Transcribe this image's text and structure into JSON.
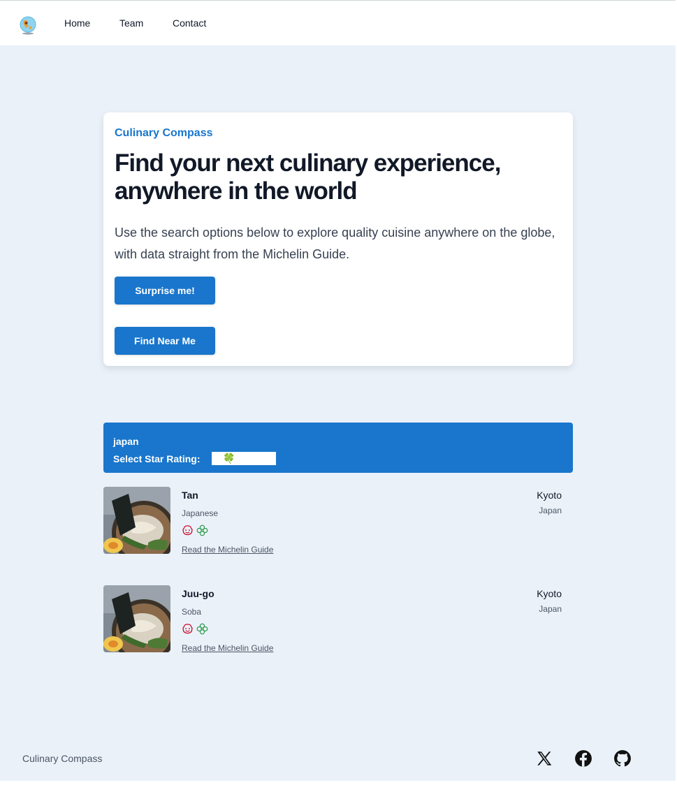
{
  "nav": {
    "logo_icon": "globe-logo-icon",
    "links": [
      "Home",
      "Team",
      "Contact"
    ]
  },
  "hero": {
    "kicker": "Culinary Compass",
    "title": "Find your next culinary experience, anywhere in the world",
    "description": "Use the search options below to explore quality cuisine anywhere on the globe, with data straight from the Michelin Guide.",
    "surprise_label": "Surprise me!",
    "near_label": "Find Near Me"
  },
  "filter": {
    "query": "japan",
    "star_label": "Select Star Rating:",
    "star_selected": "🍀"
  },
  "results": [
    {
      "name": "Tan",
      "cuisine": "Japanese",
      "link": "Read the Michelin Guide",
      "city": "Kyoto",
      "country": "Japan",
      "icons": [
        "bib-gourmand-icon",
        "green-star-icon"
      ]
    },
    {
      "name": "Juu-go",
      "cuisine": "Soba",
      "link": "Read the Michelin Guide",
      "city": "Kyoto",
      "country": "Japan",
      "icons": [
        "bib-gourmand-icon",
        "green-star-icon"
      ]
    }
  ],
  "footer": {
    "name": "Culinary Compass",
    "social_icons": [
      "x-icon",
      "facebook-icon",
      "github-icon"
    ]
  },
  "colors": {
    "accent": "#1976cc",
    "page_bg": "#eaf1f9",
    "bib_red": "#c8102e",
    "green_star": "#2e9a4a"
  }
}
